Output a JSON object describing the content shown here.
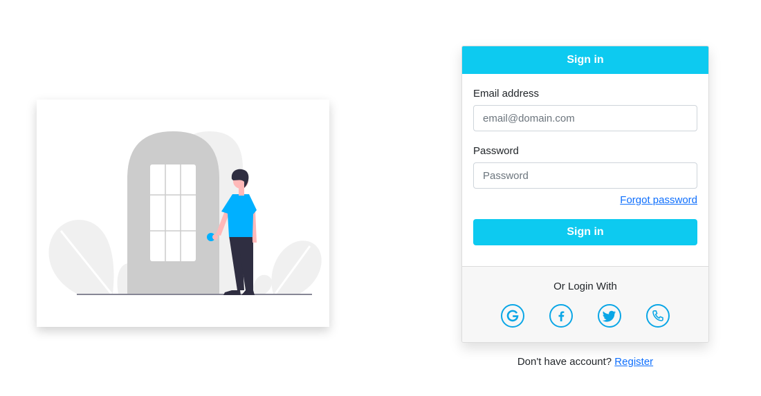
{
  "login": {
    "header_title": "Sign in",
    "email_label": "Email address",
    "email_placeholder": "email@domain.com",
    "email_value": "",
    "password_label": "Password",
    "password_placeholder": "Password",
    "password_value": "",
    "forgot_link": "Forgot password",
    "submit_label": "Sign in",
    "alt_login_text": "Or Login With",
    "social_buttons": [
      {
        "name": "google",
        "icon": "google-icon"
      },
      {
        "name": "facebook",
        "icon": "facebook-icon"
      },
      {
        "name": "twitter",
        "icon": "twitter-icon"
      },
      {
        "name": "phone",
        "icon": "phone-icon"
      }
    ]
  },
  "register": {
    "prompt": "Don't have account?",
    "link": "Register"
  },
  "theme": {
    "accent": "#0dcaf0",
    "social_icon": "#0aa6e6",
    "link": "#0d6efd",
    "illustration_person_shirt": "#00b0ff"
  }
}
